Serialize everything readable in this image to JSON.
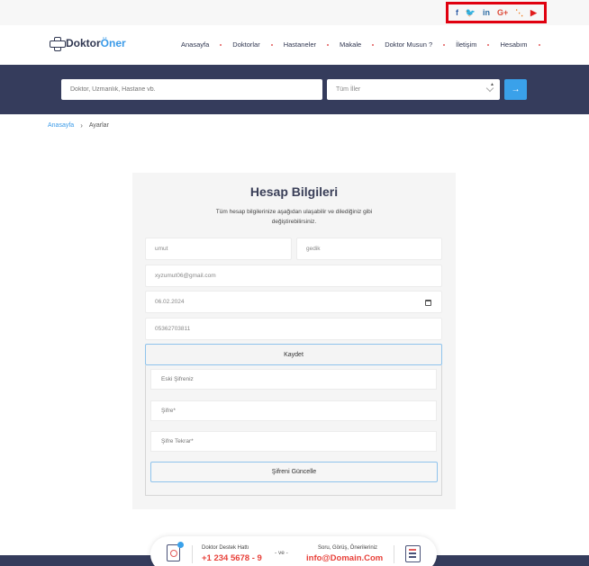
{
  "social": {
    "items": [
      {
        "name": "facebook-icon",
        "glyph": "f"
      },
      {
        "name": "twitter-icon",
        "glyph": "🐦"
      },
      {
        "name": "linkedin-icon",
        "glyph": "in"
      },
      {
        "name": "google-plus-icon",
        "glyph": "G+"
      },
      {
        "name": "rss-icon",
        "glyph": "⋱"
      },
      {
        "name": "youtube-icon",
        "glyph": "▶"
      }
    ],
    "highlight_color": "#e0000f"
  },
  "logo": {
    "part1": "Doktor",
    "part2": "Öner"
  },
  "nav": {
    "items": [
      "Anasayfa",
      "Doktorlar",
      "Hastaneler",
      "Makale",
      "Doktor Musun ?",
      "İletişim",
      "Hesabım"
    ]
  },
  "search": {
    "placeholder": "Doktor, Uzmanlık, Hastane vb.",
    "city_select": "Tüm İller",
    "button_glyph": "→"
  },
  "breadcrumb": {
    "home": "Anasayfa",
    "separator": "›",
    "current": "Ayarlar"
  },
  "account": {
    "title": "Hesap Bilgileri",
    "description": "Tüm hesap bilgilerinize aşağıdan ulaşabilir ve dilediğiniz gibi değiştirebilirsiniz.",
    "first_name": "umut",
    "last_name": "gedik",
    "email": "xyzumut06@gmail.com",
    "birth_date": "06.02.2024",
    "phone": "05362703811",
    "save_label": "Kaydet"
  },
  "password": {
    "old_placeholder": "Eski Şifreniz",
    "new_placeholder": "Şifre*",
    "repeat_placeholder": "Şifre Tekrar*",
    "update_label": "Şifreni Güncelle"
  },
  "support": {
    "hotline_label": "Doktor Destek Hattı",
    "hotline_value": "+1 234 5678 - 9",
    "separator": "- ve -",
    "feedback_label": "Soru, Görüş, Önerileriniz",
    "feedback_value": "info@Domain.Com"
  },
  "colors": {
    "primary_dark": "#353c5c",
    "accent_blue": "#3aa1ea",
    "accent_red": "#e8413a"
  }
}
